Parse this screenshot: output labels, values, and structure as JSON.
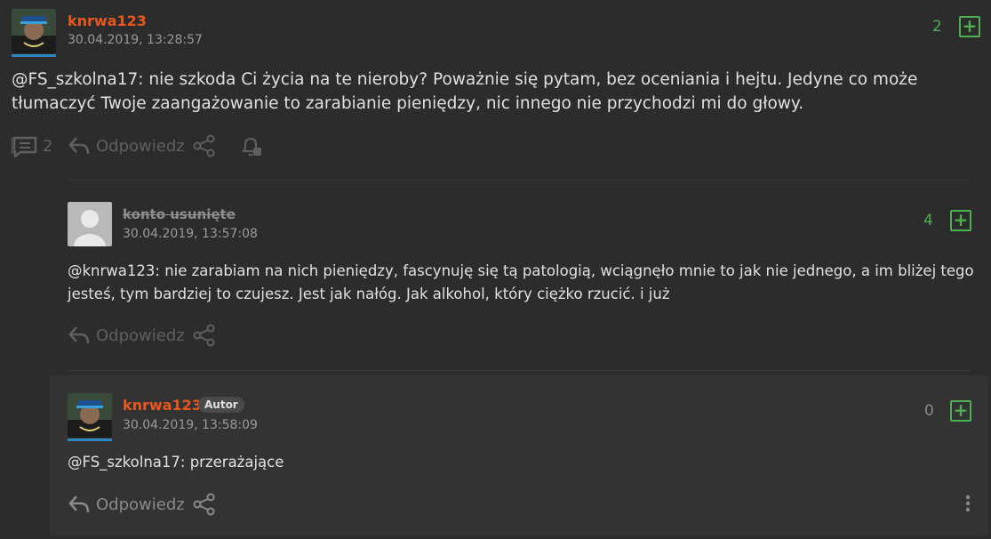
{
  "comments": [
    {
      "username": "knrwa123",
      "timestamp": "30.04.2019, 13:28:57",
      "mention": "@FS_szkolna17",
      "text_line1": ": nie szkoda Ci życia na te nieroby? Poważnie się pytam, bez oceniania i hejtu. Jedyne co może",
      "text_line2": "tłumaczyć Twoje zaangażowanie to zarabianie pieniędzy, nic innego nie przychodzi mi do głowy.",
      "score": "2",
      "reply_count": "2",
      "reply_label": "Odpowiedz"
    },
    {
      "username": "konto usunięte",
      "timestamp": "30.04.2019, 13:57:08",
      "mention": "@knrwa123",
      "text_line1": ": nie zarabiam na nich pieniędzy, fascynuję się tą patologią, wciągnęło mnie to jak nie jednego, a im bliżej tego",
      "text_line2": "jesteś, tym bardziej to czujesz. Jest jak nałóg. Jak alkohol, który ciężko rzucić. i już",
      "score": "4",
      "reply_label": "Odpowiedz"
    },
    {
      "username": "knrwa123",
      "badge": "Autor",
      "timestamp": "30.04.2019, 13:58:09",
      "mention": "@FS_szkolna17",
      "text_line1": ": przerażające",
      "score": "0",
      "reply_label": "Odpowiedz"
    }
  ],
  "colors": {
    "background": "#2c2c2c",
    "username": "#e8581c",
    "score_green": "#4caf50",
    "muted": "#5f5f5f"
  }
}
